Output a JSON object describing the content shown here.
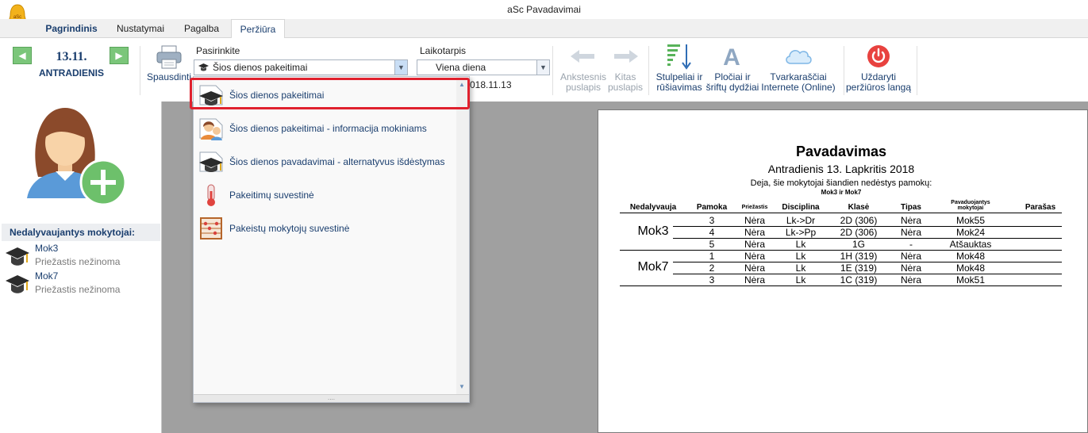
{
  "app": {
    "title": "aSc Pavadavimai",
    "logo_text": "aSc"
  },
  "tabs": [
    "Pagrindinis",
    "Nustatymai",
    "Pagalba",
    "Peržiūra"
  ],
  "ribbon": {
    "date": {
      "day": "13.11.",
      "weekday": "ANTRADIENIS"
    },
    "print_label": "Spausdinti",
    "pasirinkite": {
      "label": "Pasirinkite",
      "value": "Šios dienos pakeitimai"
    },
    "laikotarpis": {
      "label": "Laikotarpis",
      "value": "Viena diena",
      "date": "2018.11.13",
      "date_visible": "018.11.13"
    },
    "prev_page": [
      "Ankstesnis",
      "puslapis"
    ],
    "next_page": [
      "Kitas",
      "puslapis"
    ],
    "columns": [
      "Stulpeliai ir",
      "rūšiavimas"
    ],
    "widths": [
      "Pločiai ir",
      "šriftų dydžiai"
    ],
    "online": [
      "Tvarkaraščiai",
      "Internete (Online)"
    ],
    "close": [
      "Uždaryti",
      "peržiūros langą"
    ]
  },
  "left": {
    "header": "Nedalyvaujantys mokytojai:",
    "teachers": [
      {
        "name": "Mok3",
        "reason": "Priežastis nežinoma"
      },
      {
        "name": "Mok7",
        "reason": "Priežastis nežinoma"
      }
    ]
  },
  "dropdown": {
    "items": [
      {
        "label": "Šios dienos pakeitimai",
        "icon": "graduation-cap-icon"
      },
      {
        "label": "Šios dienos pakeitimai - informacija mokiniams",
        "icon": "students-icon"
      },
      {
        "label": "Šios dienos pavadavimai - alternatyvus išdėstymas",
        "icon": "graduation-cap-icon"
      },
      {
        "label": "Pakeitimų suvestinė",
        "icon": "thermometer-icon"
      },
      {
        "label": "Pakeistų mokytojų suvestinė",
        "icon": "abacus-icon"
      }
    ]
  },
  "document": {
    "title": "Pavadavimas",
    "subtitle": "Antradienis 13. Lapkritis 2018",
    "note": "Deja, šie mokytojai šiandien nedėstys pamokų:",
    "note2": "Mok3 ir Mok7",
    "columns": [
      "Nedalyvauja",
      "Pamoka",
      "Priežastis",
      "Disciplina",
      "Klasė",
      "Tipas",
      "Pavaduojantys mokytojai",
      "Parašas"
    ],
    "groups": [
      {
        "teacher": "Mok3",
        "rows": [
          [
            "3",
            "Nėra",
            "Lk->Dr",
            "2D (306)",
            "Nėra",
            "Mok55"
          ],
          [
            "4",
            "Nėra",
            "Lk->Pp",
            "2D (306)",
            "Nėra",
            "Mok24"
          ],
          [
            "5",
            "Nėra",
            "Lk",
            "1G",
            "-",
            "Atšauktas"
          ]
        ]
      },
      {
        "teacher": "Mok7",
        "rows": [
          [
            "1",
            "Nėra",
            "Lk",
            "1H (319)",
            "Nėra",
            "Mok48"
          ],
          [
            "2",
            "Nėra",
            "Lk",
            "1E (319)",
            "Nėra",
            "Mok48"
          ],
          [
            "3",
            "Nėra",
            "Lk",
            "1C (319)",
            "Nėra",
            "Mok51"
          ]
        ]
      }
    ]
  }
}
